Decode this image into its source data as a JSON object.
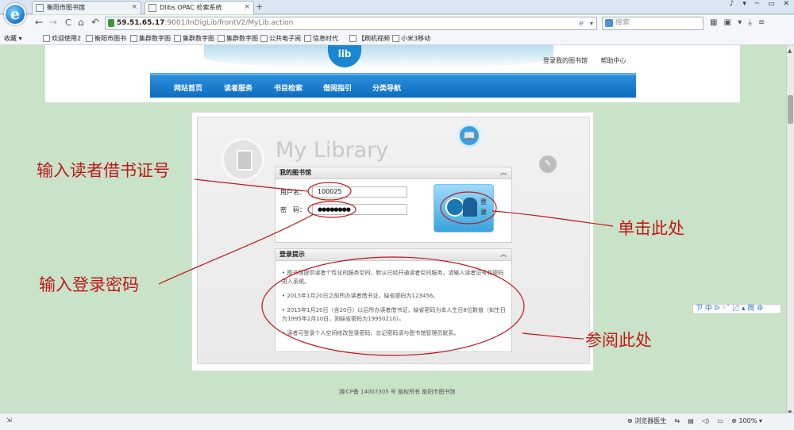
{
  "browser": {
    "logo_letter": "e",
    "tabs": [
      {
        "title": "衡阳市图书馆",
        "close": "×"
      },
      {
        "title": "Dlibs OPAC 检索系统",
        "close": "×"
      }
    ],
    "new_tab": "+",
    "window_controls": "♪ ▾ ─ ▭ ✕",
    "nav": {
      "back": "←",
      "forward": "→",
      "reload": "C",
      "home": "⌂",
      "undo": "↶"
    },
    "address": {
      "host": "59.51.65.17",
      "path": ":9001/InDigLib/frontV2/MyLib.action",
      "mode_icon": "ℯ",
      "dropdown": "▾"
    },
    "search_placeholder": "搜索",
    "right_icons": "▦ ▣ ▾ ⤓ ≡",
    "bookmarks": [
      "收藏 ▾",
      "欢迎使用2",
      "衡阳市图书",
      "集群数字图",
      "集群数字图",
      "集群数字图",
      "公共电子阅",
      "信息时代",
      "【刷机视频",
      "小米3移动"
    ],
    "status_left": "⇲",
    "status_right": "⊕ 浏览器医生    ⇆    ▤    ◁)    ▭    ⊕ 100% ▾"
  },
  "site": {
    "logo_text": "lib",
    "top_links": [
      "登录我的图书馆",
      "帮助中心"
    ],
    "menu": [
      "网站首页",
      "读者服务",
      "书目检索",
      "借阅指引",
      "分类导航"
    ]
  },
  "mylib": {
    "title": "My Library",
    "book_icon": "📖",
    "note_icon": "✎",
    "login_box": {
      "header": "我的图书馆",
      "chevron": "︽",
      "username_label": "用户名：",
      "username_value": "100025",
      "password_label": "密　码：",
      "password_value": "●●●●●●●●",
      "login_button": "登录"
    },
    "tips_box": {
      "header": "登录提示",
      "chevron": "︽",
      "tips": [
        "• 图书馆提供读者个性化的服务空间，默认已经开通读者空间服务，请输入读者证号和密码进入系统。",
        "• 2015年1月20日之前所办读者借书证，缺省密码为123456。",
        "• 2015年1月20日（含20日）以后所办读者借书证，缺省密码为本人生日8位数值（如生日为1995年2月10日，则缺省密码为19950210）。",
        "• 读者可登录个人空间修改登录密码，忘记密码请与图书馆管理员联系。"
      ]
    }
  },
  "footer": "湘ICP备 14007305 号 版权所有 衡阳市图书馆",
  "ime_bar": "ㄗ 中 ᐅ ◦ˇ 〼 ▴ 简 ⚙",
  "annotations": {
    "enter_card": "输入读者借书证号",
    "enter_password": "输入登录密码",
    "click_here": "单击此处",
    "see_here": "参阅此处"
  }
}
